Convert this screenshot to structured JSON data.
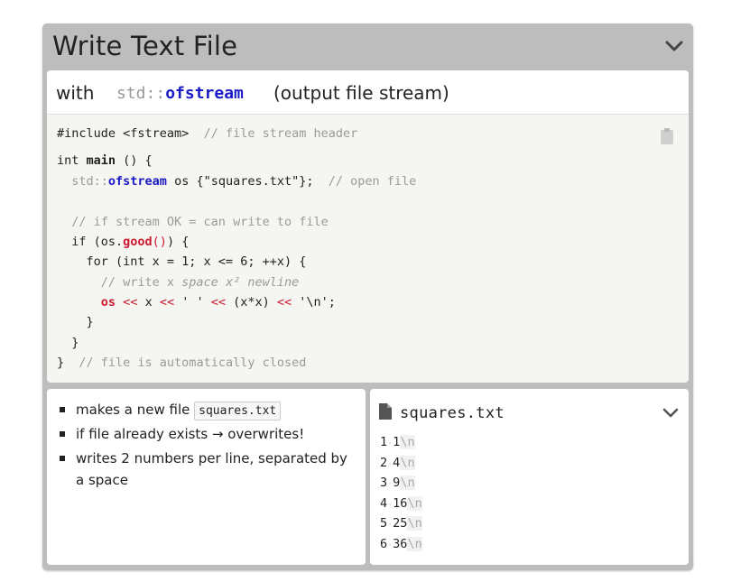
{
  "panel": {
    "title": "Write Text File",
    "with_word": "with",
    "with_ns": "std::",
    "with_type": "ofstream",
    "with_note": "(output file stream)"
  },
  "code": {
    "l1_a": "#include <fstream>",
    "l1_c": "  // file stream header",
    "l2_a": "int ",
    "l2_b": "main",
    "l2_c": " () {",
    "l3_ns": "  std::",
    "l3_t": "ofstream",
    "l3_a": " os {\"squares.txt\"};",
    "l3_c": "  // open file",
    "l4_c": "  // if stream OK = can write to file",
    "l5_a": "  if (os.",
    "l5_b": "good",
    "l5_c": "()",
    "l5_d": ") {",
    "l6": "    for (int x = 1; x <= 6; ++x) {",
    "l7_c": "      // write x ",
    "l7_i": "space x² newline",
    "l8_a": "      ",
    "l8_os": "os",
    "l8_o1": " << ",
    "l8_x": "x",
    "l8_o2": " << ",
    "l8_sp": "' '",
    "l8_o3": " << ",
    "l8_xx": "(x*x)",
    "l8_o4": " << ",
    "l8_nl": "'\\n';",
    "l9": "    }",
    "l10": "  }",
    "l11_a": "}",
    "l11_c": "  // file is automatically closed"
  },
  "notes": {
    "item1_text": "makes a new file",
    "item1_file": "squares.txt",
    "item2": "if file already exists → overwrites!",
    "item3": "writes 2 numbers per line, separated by a space"
  },
  "file": {
    "name": "squares.txt",
    "lines": [
      {
        "n": "1",
        "v": "1"
      },
      {
        "n": "2",
        "v": "4"
      },
      {
        "n": "3",
        "v": "9"
      },
      {
        "n": "4",
        "v": "16"
      },
      {
        "n": "5",
        "v": "25"
      },
      {
        "n": "6",
        "v": "36"
      }
    ],
    "nl": "\\n"
  },
  "icons": [
    "chevron-down-icon",
    "clipboard-icon",
    "file-icon"
  ]
}
